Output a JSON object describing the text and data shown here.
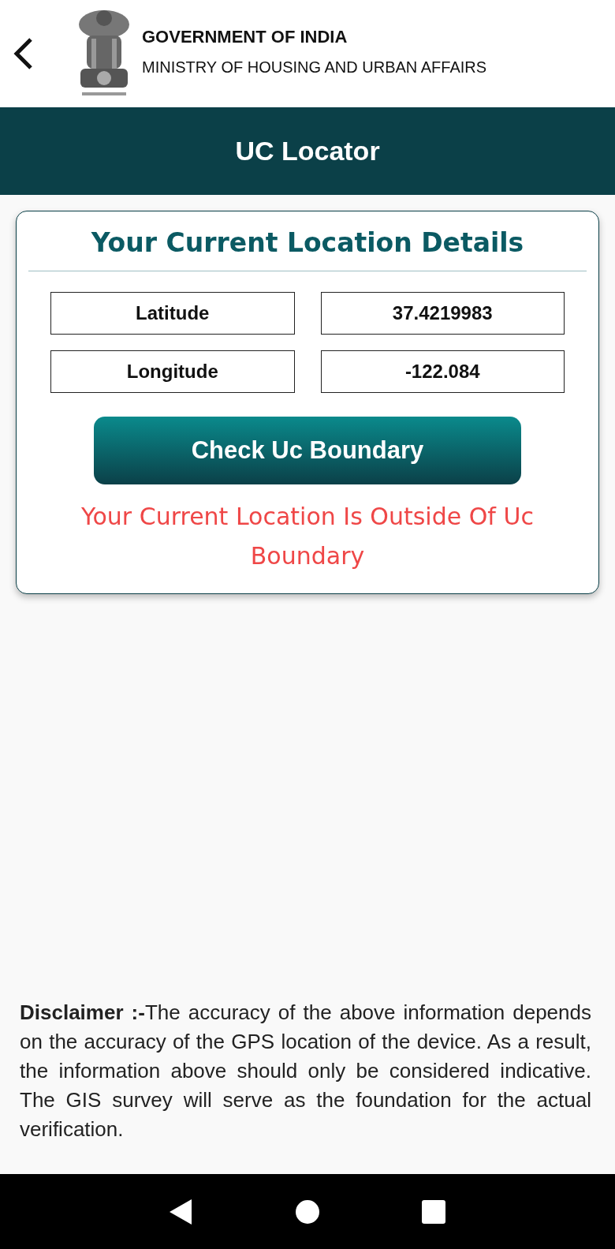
{
  "header": {
    "title": "GOVERNMENT OF INDIA",
    "subtitle": "MINISTRY OF HOUSING AND URBAN AFFAIRS"
  },
  "title_bar": {
    "title": "UC Locator"
  },
  "card": {
    "heading": "Your Current Location Details",
    "fields": [
      {
        "label": "Latitude",
        "value": "37.4219983"
      },
      {
        "label": "Longitude",
        "value": "-122.084"
      }
    ],
    "button": "Check Uc Boundary",
    "result": "Your Current Location Is Outside Of Uc Boundary"
  },
  "disclaimer": "**Disclaimer :-**The accuracy of the above information depends on the accuracy of the GPS location of the device. As a result, the information above should only be considered indicative. The GIS survey will serve as the foundation for the actual verification."
}
